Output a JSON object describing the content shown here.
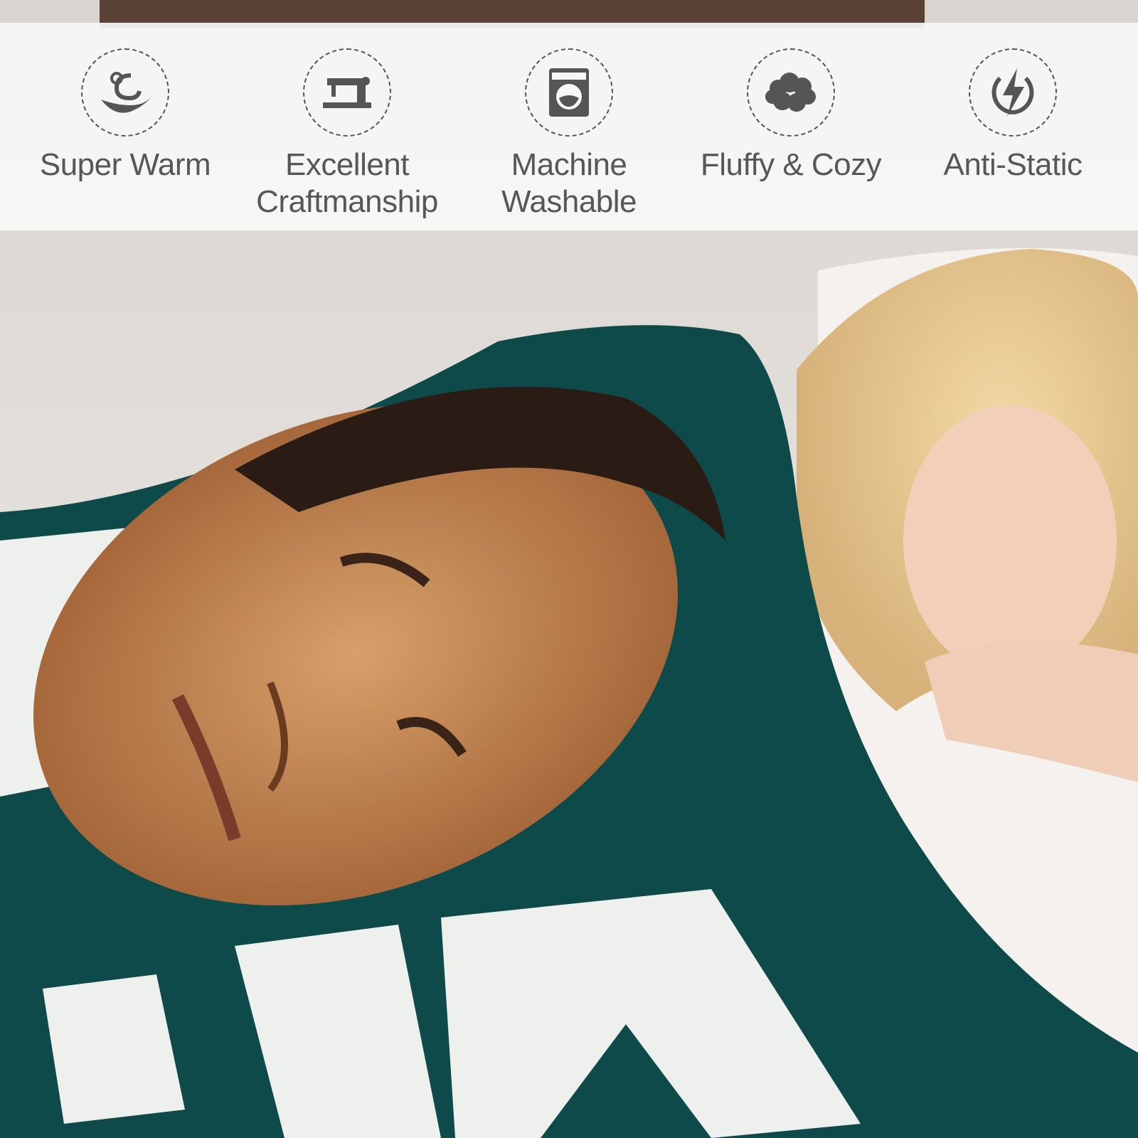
{
  "features": [
    {
      "icon": "warm-icon",
      "label": "Super Warm"
    },
    {
      "icon": "sewing-machine-icon",
      "label": "Excellent\nCraftmanship"
    },
    {
      "icon": "washing-machine-icon",
      "label": "Machine\nWashable"
    },
    {
      "icon": "cloud-icon",
      "label": "Fluffy & Cozy"
    },
    {
      "icon": "lightning-icon",
      "label": "Anti-Static"
    }
  ],
  "colors": {
    "banner_bg": "#f7f7f7",
    "icon_gray": "#555555",
    "label_gray": "#575757",
    "blanket_teal": "#0f4a4a",
    "skin": "#c98a55"
  }
}
